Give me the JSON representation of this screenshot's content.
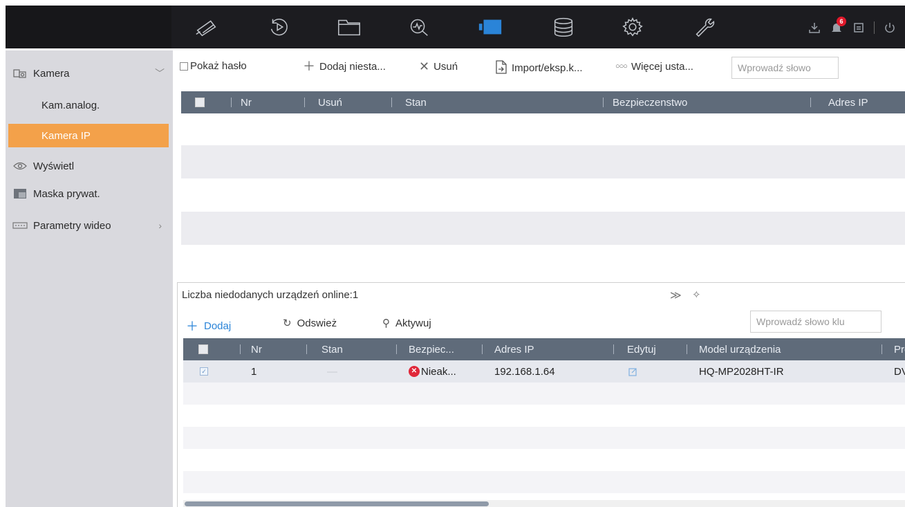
{
  "topbar": {
    "nav_icons": [
      "camera-icon",
      "playback-icon",
      "folder-icon",
      "search-analysis-icon",
      "video-camera-icon",
      "storage-icon",
      "settings-icon",
      "maintenance-icon"
    ],
    "active_icon": "video-camera-icon",
    "alarm_count": "6",
    "accent": "#2a84d8"
  },
  "sidebar": {
    "items": [
      {
        "label": "Kamera",
        "icon": "camera-channel-icon"
      },
      {
        "label": "Kam.analog."
      },
      {
        "label": "Kamera IP"
      },
      {
        "label": "Wyświetl",
        "icon": "eye-icon"
      },
      {
        "label": "Maska prywat.",
        "icon": "privacy-mask-icon"
      },
      {
        "label": "Parametry wideo",
        "icon": "video-params-icon"
      }
    ],
    "active_color": "#f3a14a"
  },
  "toolbar": {
    "show_password": "Pokaż hasło",
    "add": "Dodaj niesta...",
    "delete": "Usuń",
    "import_export": "Import/eksp.k...",
    "more": "Więcej usta...",
    "search_placeholder": "Wprowadź słowo"
  },
  "main_table": {
    "headers": [
      "Nr",
      "Usuń",
      "Stan",
      "Bezpieczenstwo",
      "Adres IP"
    ]
  },
  "online_panel": {
    "title": "Liczba niedodanych urządzeń online:1",
    "add": "Dodaj",
    "refresh": "Odswież",
    "activate": "Aktywuj",
    "search_placeholder": "Wprowadź słowo klu",
    "headers": [
      "Nr",
      "Stan",
      "Bezpiec...",
      "Adres IP",
      "Edytuj",
      "Model urządzenia",
      "Prot"
    ],
    "rows": [
      {
        "nr": "1",
        "stan": "—",
        "bezpieczenstwo": "Nieak...",
        "ip": "192.168.1.64",
        "model": "HQ-MP2028HT-IR",
        "protocol": "DVS"
      }
    ]
  }
}
